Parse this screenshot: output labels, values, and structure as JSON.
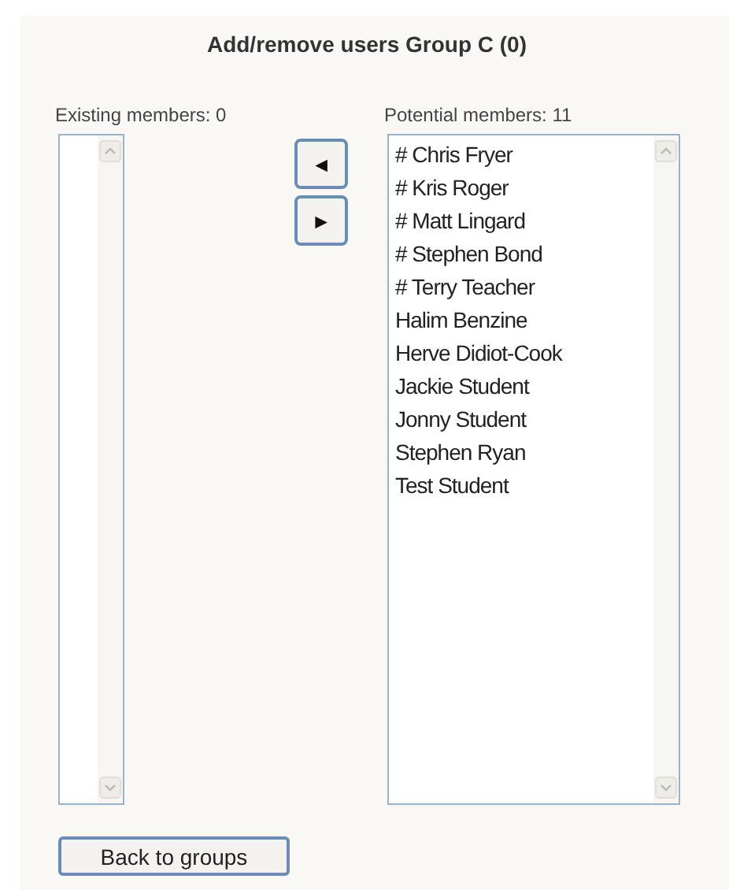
{
  "title": "Add/remove users Group C (0)",
  "existing": {
    "label": "Existing members: 0"
  },
  "buttons": [
    {
      "label": "◄"
    },
    {
      "label": "►"
    }
  ],
  "potential": {
    "label": "Potential members: 11",
    "items": [
      "# Chris Fryer",
      "# Kris Roger",
      "# Matt Lingard",
      "# Stephen Bond",
      "# Terry Teacher",
      "Halim Benzine",
      "Herve Didiot-Cook",
      "Jackie Student",
      "Jonny Student",
      "Stephen Ryan",
      "Test Student"
    ]
  },
  "back_button": "Back to groups"
}
